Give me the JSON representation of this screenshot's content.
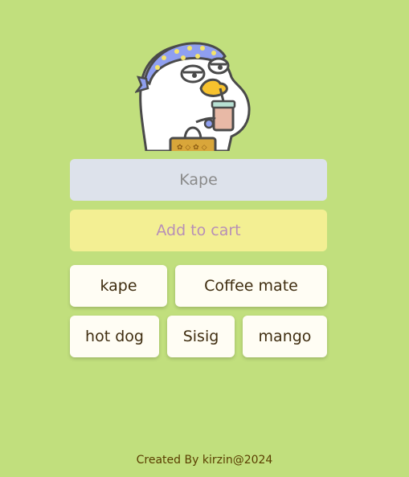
{
  "mascot": {
    "icon": "duck-mascot-drinking-coffee-icon"
  },
  "input": {
    "placeholder": "Kape",
    "value": ""
  },
  "add_button": {
    "label": "Add to cart"
  },
  "quick_items": [
    {
      "label": "kape"
    },
    {
      "label": "Coffee mate"
    },
    {
      "label": "hot dog"
    },
    {
      "label": "Sisig"
    },
    {
      "label": "mango"
    }
  ],
  "footer": {
    "text": "Created By kirzin@2024"
  },
  "colors": {
    "background": "#c1df7d",
    "input_bg": "#dde2eb",
    "add_button_bg": "#f3ef93",
    "add_button_text": "#b78fb7",
    "chip_bg": "#fffdf4",
    "chip_text": "#3f2d10",
    "footer_text": "#5a3e00"
  }
}
